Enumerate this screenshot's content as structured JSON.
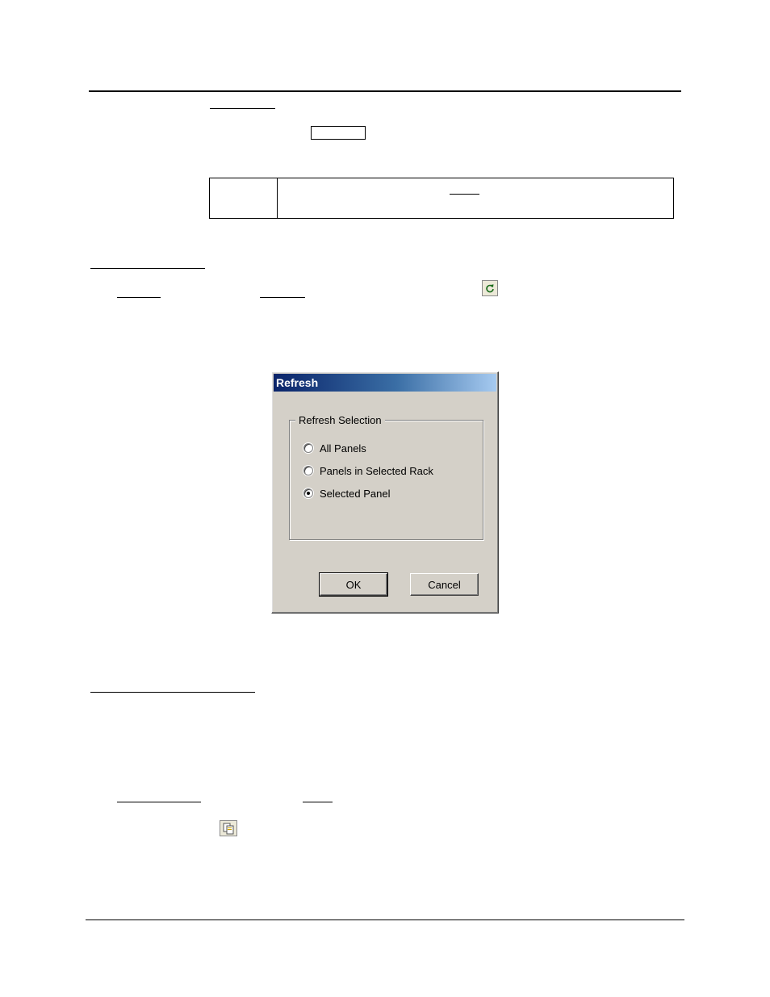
{
  "dialog": {
    "title": "Refresh",
    "group_label": "Refresh Selection",
    "options": [
      {
        "label": "All Panels",
        "checked": false
      },
      {
        "label": "Panels in Selected Rack",
        "checked": false
      },
      {
        "label": "Selected Panel",
        "checked": true
      }
    ],
    "ok_label": "OK",
    "cancel_label": "Cancel"
  },
  "icons": {
    "refresh": "refresh-icon",
    "copy": "copy-icon"
  }
}
